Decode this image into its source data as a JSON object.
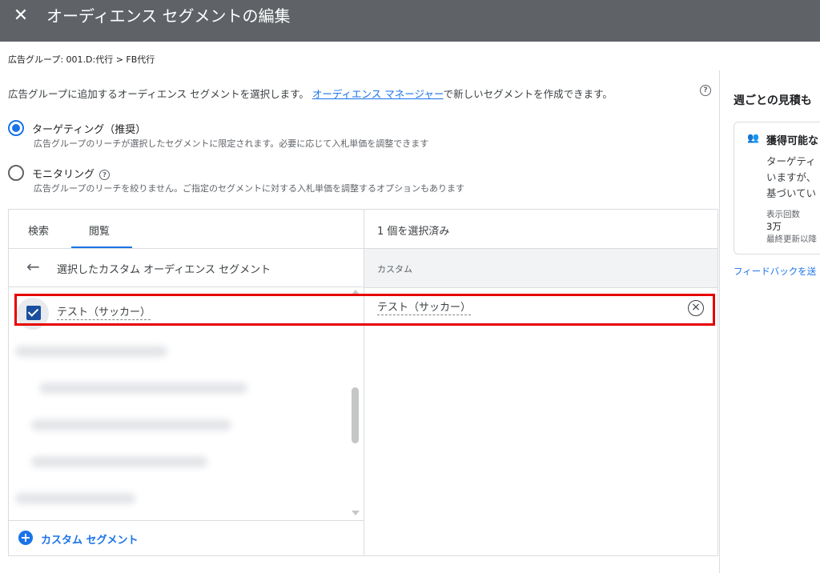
{
  "header": {
    "title": "オーディエンス セグメントの編集",
    "close_icon": "close-icon"
  },
  "breadcrumb": "広告グループ: 001.D:代行 > FB代行",
  "intro": {
    "text_before": "広告グループに追加するオーディエンス セグメントを選択します。",
    "link": "オーディエンス マネージャー",
    "text_after": "で新しいセグメントを作成できます。",
    "help": "?"
  },
  "options": {
    "targeting": {
      "label": "ターゲティング（推奨）",
      "desc": "広告グループのリーチが選択したセグメントに限定されます。必要に応じて入札単価を調整できます",
      "selected": true
    },
    "monitoring": {
      "label": "モニタリング",
      "help": "?",
      "desc": "広告グループのリーチを絞りません。ご指定のセグメントに対する入札単価を調整するオプションもあります",
      "selected": false
    }
  },
  "left_panel": {
    "tabs": [
      {
        "label": "検索",
        "active": false
      },
      {
        "label": "閲覧",
        "active": true
      }
    ],
    "back_arrow": "←",
    "back_title": "選択したカスタム オーディエンス セグメント",
    "items": [
      {
        "label": "テスト（サッカー）",
        "checked": true
      }
    ],
    "add_icon": "+",
    "add_label": "カスタム セグメント"
  },
  "right_panel": {
    "selected_count": "1 個を選択済み",
    "column_header": "カスタム",
    "items": [
      {
        "label": "テスト（サッカー）"
      }
    ],
    "remove_icon": "×"
  },
  "estimate": {
    "title": "週ごとの見積も",
    "card_title": "獲得可能な",
    "people_icon": "👥",
    "line1": "ターゲティ",
    "line2": "いますが、",
    "line3": "基づいてい",
    "impressions_label": "表示回数",
    "impressions_value": "3万",
    "updated": "最終更新以降",
    "feedback": "フィードバックを送"
  },
  "colors": {
    "topbar": "#5f6368",
    "accent": "#1a73e8",
    "highlight": "#e60000"
  }
}
